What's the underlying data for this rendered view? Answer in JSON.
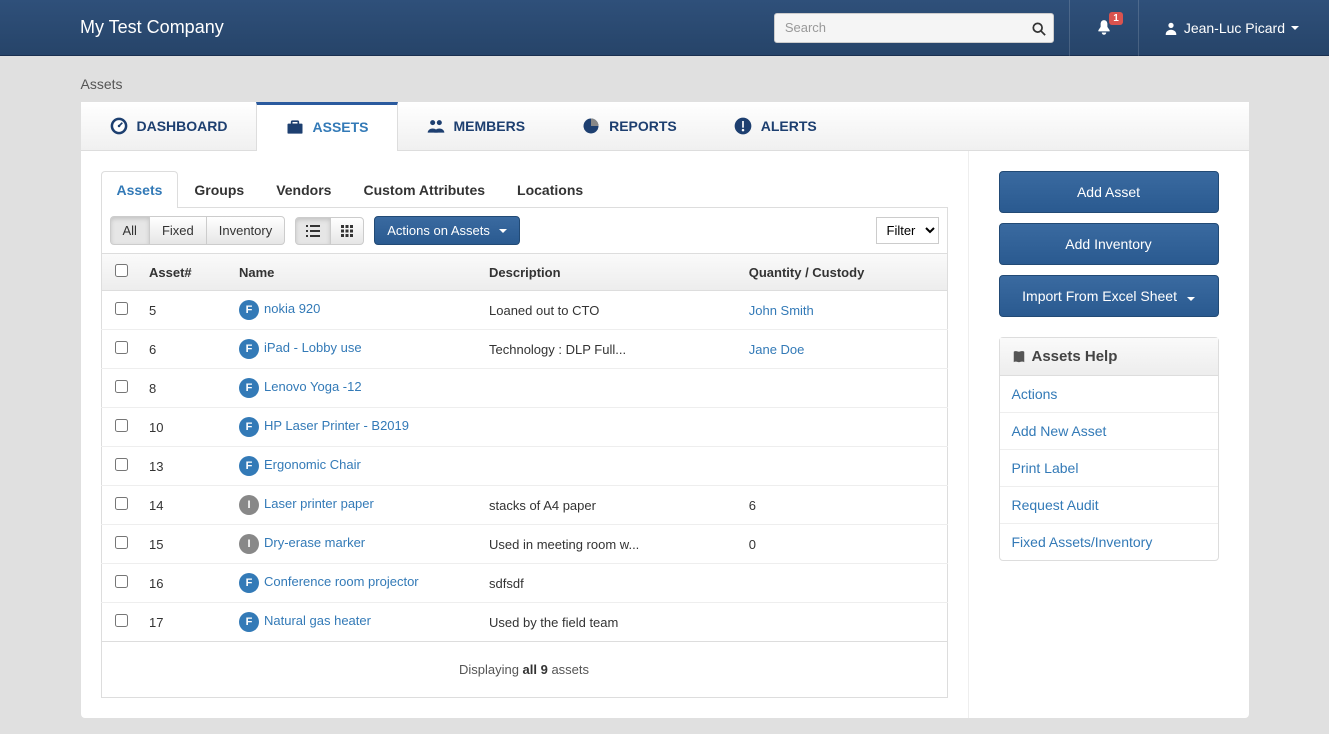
{
  "header": {
    "brand": "My Test Company",
    "search_placeholder": "Search",
    "notification_count": "1",
    "user_name": "Jean-Luc Picard"
  },
  "page_title": "Assets",
  "main_tabs": [
    {
      "label": "DASHBOARD",
      "icon": "gauge"
    },
    {
      "label": "ASSETS",
      "icon": "briefcase"
    },
    {
      "label": "MEMBERS",
      "icon": "people"
    },
    {
      "label": "REPORTS",
      "icon": "pie"
    },
    {
      "label": "ALERTS",
      "icon": "warn"
    }
  ],
  "active_main_tab": 1,
  "sub_tabs": [
    "Assets",
    "Groups",
    "Vendors",
    "Custom Attributes",
    "Locations"
  ],
  "active_sub_tab": 0,
  "toolbar": {
    "filter_all": "All",
    "filter_fixed": "Fixed",
    "filter_inventory": "Inventory",
    "actions_label": "Actions on Assets",
    "filter_select": "Filter"
  },
  "table": {
    "columns": [
      "",
      "Asset#",
      "Name",
      "Description",
      "Quantity / Custody"
    ],
    "rows": [
      {
        "asset_no": "5",
        "type": "F",
        "name": "nokia 920",
        "description": "Loaned out to CTO",
        "custody": "John Smith",
        "custody_link": true
      },
      {
        "asset_no": "6",
        "type": "F",
        "name": "iPad - Lobby use",
        "description": "Technology : DLP Full...",
        "custody": "Jane Doe",
        "custody_link": true
      },
      {
        "asset_no": "8",
        "type": "F",
        "name": "Lenovo Yoga -12",
        "description": "",
        "custody": ""
      },
      {
        "asset_no": "10",
        "type": "F",
        "name": "HP Laser Printer - B2019",
        "description": "",
        "custody": ""
      },
      {
        "asset_no": "13",
        "type": "F",
        "name": "Ergonomic Chair",
        "description": "",
        "custody": ""
      },
      {
        "asset_no": "14",
        "type": "I",
        "name": "Laser printer paper",
        "description": "stacks of A4 paper",
        "custody": "6"
      },
      {
        "asset_no": "15",
        "type": "I",
        "name": "Dry-erase marker",
        "description": "Used in meeting room w...",
        "custody": "0"
      },
      {
        "asset_no": "16",
        "type": "F",
        "name": "Conference room projector",
        "description": "sdfsdf",
        "custody": ""
      },
      {
        "asset_no": "17",
        "type": "F",
        "name": "Natural gas heater",
        "description": "Used by the field team",
        "custody": ""
      }
    ],
    "footer_prefix": "Displaying ",
    "footer_bold": "all 9",
    "footer_suffix": " assets"
  },
  "sidebar": {
    "add_asset": "Add Asset",
    "add_inventory": "Add Inventory",
    "import_excel": "Import From Excel Sheet",
    "help_title": "Assets Help",
    "help_links": [
      "Actions",
      "Add New Asset",
      "Print Label",
      "Request Audit",
      "Fixed Assets/Inventory"
    ]
  }
}
